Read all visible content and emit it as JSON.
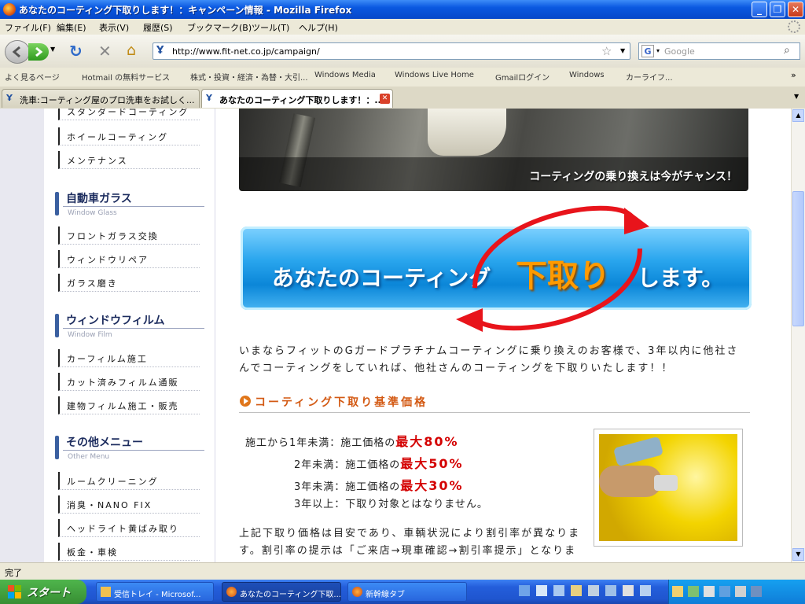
{
  "window": {
    "title": "あなたのコーティング下取りします！：キャンペーン情報 - Mozilla Firefox"
  },
  "menu": [
    "ファイル(F)",
    "編集(E)",
    "表示(V)",
    "履歴(S)",
    "ブックマーク(B)",
    "ツール(T)",
    "ヘルプ(H)"
  ],
  "nav": {
    "url": "http://www.fit-net.co.jp/campaign/",
    "search_placeholder": "Google"
  },
  "bookmarks": [
    "よく見るページ",
    "Hotmail の無料サービス",
    "株式・投資・経済・為替・大引...",
    "Windows Media",
    "Windows Live Home",
    "Gmailログイン",
    "Windows",
    "カーライフ... "
  ],
  "tabs": [
    {
      "label": "洗車:コーティング屋のプロ洗車をお試しく...",
      "active": false
    },
    {
      "label": "あなたのコーティング下取りします！：...",
      "active": true
    }
  ],
  "sidebar": {
    "top_items": [
      "スタンダードコーティング",
      "ホイールコーティング",
      "メンテナンス"
    ],
    "categories": [
      {
        "title": "自動車ガラス",
        "subtitle": "Window Glass",
        "items": [
          "フロントガラス交換",
          "ウィンドウリペア",
          "ガラス磨き"
        ]
      },
      {
        "title": "ウィンドウフィルム",
        "subtitle": "Window Film",
        "items": [
          "カーフィルム施工",
          "カット済みフィルム通販",
          "建物フィルム施工・販売"
        ]
      },
      {
        "title": "その他メニュー",
        "subtitle": "Other Menu",
        "items": [
          "ルームクリーニング",
          "消臭・NANO FIX",
          "ヘッドライト黄ばみ取り",
          "板金・車検"
        ]
      }
    ]
  },
  "main": {
    "hero_caption": "コーティングの乗り換えは今がチャンス！",
    "banner": {
      "before": "あなたのコーティング",
      "highlight": "下取り",
      "after": "します。"
    },
    "intro": "いまならフィットのGガードプラチナムコーティングに乗り換えのお客様で、3年以内に他社さんでコーティングをしていれば、他社さんのコーティングを下取りいたします！！",
    "section_title": "コーティング下取り基準価格",
    "price_rows": [
      {
        "label": "施工から1年未満：施工価格の",
        "value": "最大80%"
      },
      {
        "label": "2年未満：施工価格の",
        "value": "最大50%"
      },
      {
        "label": "3年未満：施工価格の",
        "value": "最大30%"
      },
      {
        "label": "3年以上：下取り対象とはなりません。",
        "value": ""
      }
    ],
    "note": "上記下取り価格は目安であり、車輌状況により割引率が異なります。割引率の提示は「ご来店→現車確認→割引率提示」となりま"
  },
  "status": "完了",
  "taskbar": {
    "start": "スタート",
    "tasks": [
      "受信トレイ - Microsof...",
      "あなたのコーティング下取...",
      "新幹線タブ"
    ]
  },
  "colors": {
    "accent_orange": "#d35a14",
    "price_red": "#d40000",
    "sidebar_bar": "#3a5fa0"
  }
}
